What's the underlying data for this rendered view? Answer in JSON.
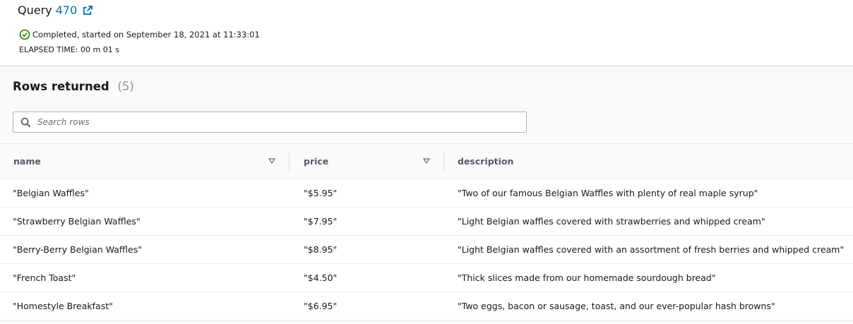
{
  "query": {
    "label": "Query",
    "id": "470",
    "status": "Completed, started on September 18, 2021 at 11:33:01",
    "elapsed": "ELAPSED TIME: 00 m 01 s"
  },
  "results": {
    "title": "Rows returned",
    "count": "(5)",
    "search_placeholder": "Search rows",
    "columns": [
      "name",
      "price",
      "description"
    ],
    "rows": [
      {
        "name": "\"Belgian Waffles\"",
        "price": "\"$5.95\"",
        "description": "\"Two of our famous Belgian Waffles with plenty of real maple syrup\""
      },
      {
        "name": "\"Strawberry Belgian Waffles\"",
        "price": "\"$7.95\"",
        "description": "\"Light Belgian waffles covered with strawberries and whipped cream\""
      },
      {
        "name": "\"Berry-Berry Belgian Waffles\"",
        "price": "\"$8.95\"",
        "description": "\"Light Belgian waffles covered with an assortment of fresh berries and whipped cream\""
      },
      {
        "name": "\"French Toast\"",
        "price": "\"$4.50\"",
        "description": "\"Thick slices made from our homemade sourdough bread\""
      },
      {
        "name": "\"Homestyle Breakfast\"",
        "price": "\"$6.95\"",
        "description": "\"Two eggs, bacon or sausage, toast, and our ever-popular hash browns\""
      }
    ]
  },
  "colors": {
    "link": "#0073bb",
    "success": "#1d8102",
    "border": "#eaeded"
  },
  "icons": {
    "external": "external-link-icon",
    "status": "status-success-icon",
    "search": "search-icon",
    "sort": "sort-caret-down-icon"
  }
}
